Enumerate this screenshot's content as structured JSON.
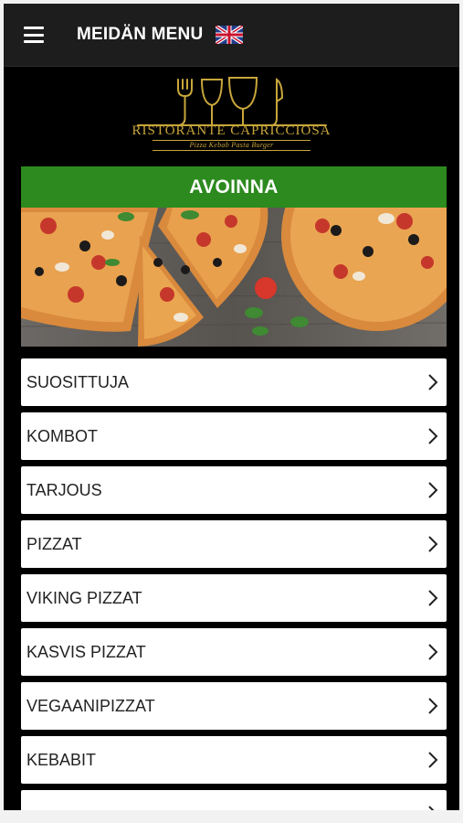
{
  "header": {
    "title": "MEIDÄN MENU",
    "menu_icon": "hamburger-menu-icon",
    "language_icon": "uk-flag-icon"
  },
  "logo": {
    "name": "RISTORANTE CAPRICCIOSA",
    "tagline": "Pizza Kebab Pasta Burger",
    "color": "#c8a63a"
  },
  "status": {
    "label": "AVOINNA",
    "color": "#2c8a1e"
  },
  "menu": {
    "items": [
      {
        "label": "SUOSITTUJA"
      },
      {
        "label": "KOMBOT"
      },
      {
        "label": "TARJOUS"
      },
      {
        "label": "PIZZAT"
      },
      {
        "label": "VIKING PIZZAT"
      },
      {
        "label": "KASVIS PIZZAT"
      },
      {
        "label": "VEGAANIPIZZAT"
      },
      {
        "label": "KEBABIT"
      },
      {
        "label": ""
      }
    ],
    "chevron_icon": "chevron-right-icon"
  }
}
